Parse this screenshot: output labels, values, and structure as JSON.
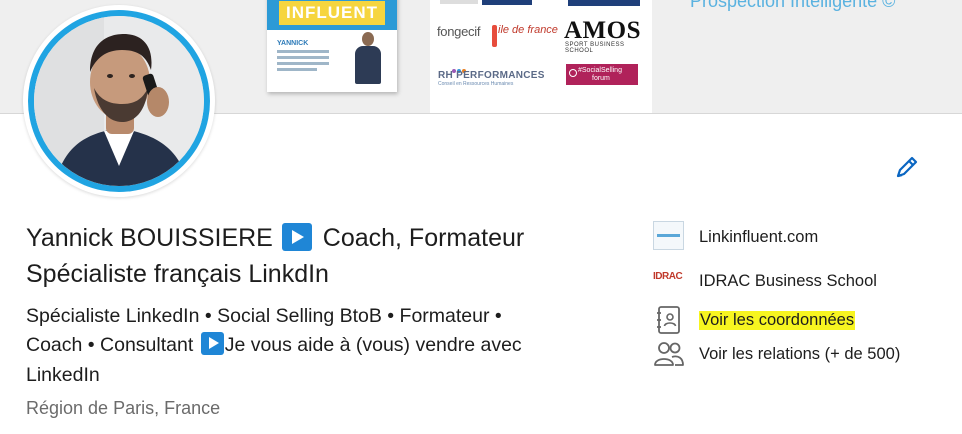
{
  "banner": {
    "book_title": "INFLUENT",
    "book_author": "YANNICK",
    "prospection_text": "Prospection Intelligente ©",
    "logos": {
      "fongecif": "fongecif",
      "ile_de_france": "ile de france",
      "amos": "AMOS",
      "amos_sub": "SPORT BUSINESS SCHOOL",
      "rh_performances": "RH PERFORMANCES",
      "rh_sub": "Conseil en Ressources Humaines",
      "social_selling_line1": "#SocialSelling",
      "social_selling_line2": "forum"
    }
  },
  "profile": {
    "name": "Yannick BOUISSIERE",
    "headline_part1": "Coach, Formateur",
    "headline_part2": "Spécialiste français LinkdIn",
    "summary_line1": "Spécialiste LinkedIn • Social Selling BtoB • Formateur •",
    "summary_line2_a": "Coach • Consultant",
    "summary_line2_b": "Je vous aide à (vous) vendre avec",
    "summary_line3": "LinkedIn",
    "location": "Région de Paris, France"
  },
  "sidebar": {
    "items": [
      {
        "label": "Linkinfluent.com",
        "icon": "company-logo"
      },
      {
        "label": "IDRAC Business School",
        "icon": "idrac-logo",
        "logo_text": "IDRAC"
      },
      {
        "label": "Voir les coordonnées",
        "icon": "contact-card-icon"
      },
      {
        "label": "Voir les relations (+ de 500)",
        "icon": "connections-icon"
      }
    ]
  },
  "colors": {
    "accent": "#0a66c2",
    "avatar_ring": "#20a4e2",
    "play_badge": "#1f86d6",
    "highlight": "#f7f520"
  }
}
